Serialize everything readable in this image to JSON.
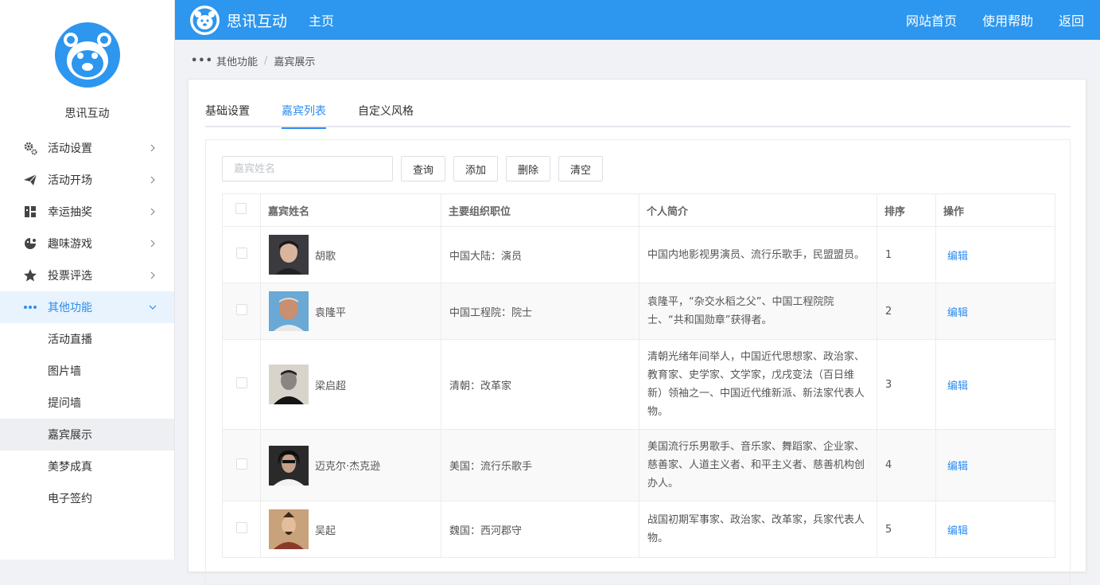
{
  "brand": {
    "name": "思讯互动"
  },
  "sidebar": {
    "items": [
      {
        "label": "活动设置",
        "icon": "gears-icon"
      },
      {
        "label": "活动开场",
        "icon": "paper-plane-icon"
      },
      {
        "label": "幸运抽奖",
        "icon": "lottery-grid-icon"
      },
      {
        "label": "趣味游戏",
        "icon": "gamepad-icon"
      },
      {
        "label": "投票评选",
        "icon": "star-icon"
      },
      {
        "label": "其他功能",
        "icon": "more-dots-icon"
      }
    ],
    "sub_items": [
      "活动直播",
      "图片墙",
      "提问墙",
      "嘉宾展示",
      "美梦成真",
      "电子签约"
    ]
  },
  "topbar": {
    "title": "思讯互动",
    "home": "主页",
    "links": [
      "网站首页",
      "使用帮助",
      "返回"
    ]
  },
  "breadcrumb": {
    "parent": "其他功能",
    "current": "嘉宾展示"
  },
  "tabs": [
    "基础设置",
    "嘉宾列表",
    "自定义风格"
  ],
  "toolbar": {
    "search_placeholder": "嘉宾姓名",
    "query": "查询",
    "add": "添加",
    "delete": "删除",
    "clear": "清空"
  },
  "table": {
    "headers": {
      "name": "嘉宾姓名",
      "position": "主要组织职位",
      "bio": "个人简介",
      "order": "排序",
      "action": "操作"
    },
    "edit_label": "编辑",
    "rows": [
      {
        "name": "胡歌",
        "position": "中国大陆：演员",
        "bio": "中国内地影视男演员、流行乐歌手，民盟盟员。",
        "order": "1"
      },
      {
        "name": "袁隆平",
        "position": "中国工程院：院士",
        "bio": "袁隆平，“杂交水稻之父”、中国工程院院士、“共和国勋章”获得者。",
        "order": "2"
      },
      {
        "name": "梁启超",
        "position": "清朝：改革家",
        "bio": "清朝光绪年间举人，中国近代思想家、政治家、教育家、史学家、文学家，戊戌变法（百日维新）领袖之一、中国近代维新派、新法家代表人物。",
        "order": "3"
      },
      {
        "name": "迈克尔·杰克逊",
        "position": "美国：流行乐歌手",
        "bio": "美国流行乐男歌手、音乐家、舞蹈家、企业家、慈善家、人道主义者、和平主义者、慈善机构创办人。",
        "order": "4"
      },
      {
        "name": "吴起",
        "position": "魏国：西河郡守",
        "bio": "战国初期军事家、政治家、改革家，兵家代表人物。",
        "order": "5"
      }
    ]
  }
}
